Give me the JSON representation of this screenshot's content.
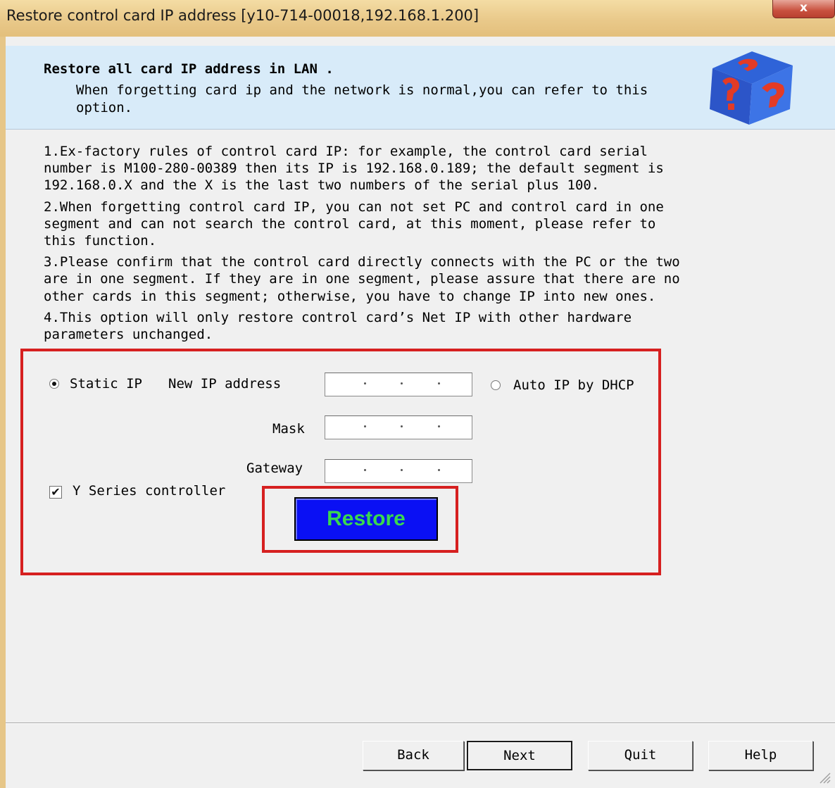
{
  "window": {
    "title": "Restore control card IP address [y10-714-00018,192.168.1.200]",
    "close_glyph": "x"
  },
  "header": {
    "title": "Restore all card IP address in LAN .",
    "description": "When forgetting card ip and the network is normal,you can refer to this option.",
    "icon": "help-cube-icon"
  },
  "rules": [
    "1.Ex-factory rules of control card IP: for example, the control card serial number is M100-280-00389 then its IP is 192.168.0.189; the default segment is 192.168.0.X and the X is the last two numbers of the serial plus 100.",
    "2.When forgetting control card IP, you can not set PC and control card in one segment and can not search the control card, at this moment, please refer to this function.",
    "3.Please confirm that the control card directly connects with the PC or the two are in one segment. If they are in one segment, please assure that there are no other cards in this segment; otherwise, you have to change IP into new ones.",
    "4.This option will only restore control card’s Net IP with other hardware parameters unchanged."
  ],
  "form": {
    "static_ip_label": "Static IP",
    "static_ip_selected": true,
    "new_ip_label": "New IP address",
    "new_ip_value": ". . .",
    "auto_ip_label": "Auto IP by DHCP",
    "auto_ip_selected": false,
    "mask_label": "Mask",
    "mask_value": ". . .",
    "gateway_label": "Gateway",
    "gateway_value": ". . .",
    "y_series_label": "Y Series controller",
    "y_series_checked": true,
    "restore_label": "Restore"
  },
  "footer": {
    "back_label": "Back",
    "next_label": "Next",
    "quit_label": "Quit",
    "help_label": "Help"
  },
  "colors": {
    "header_bg": "#d8ebf9",
    "highlight_red": "#d62020",
    "restore_bg": "#0a10f4",
    "restore_text": "#39d84f",
    "titlebar": "#e9c98a"
  }
}
